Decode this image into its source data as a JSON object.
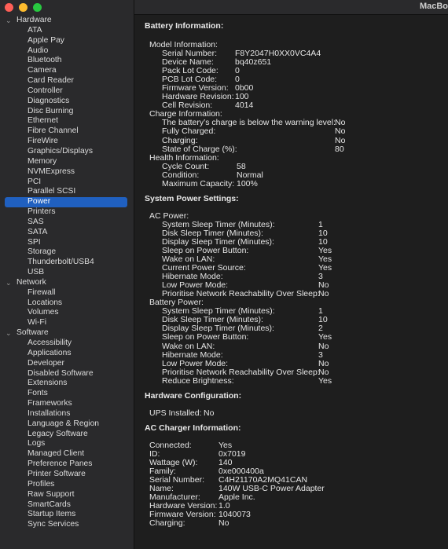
{
  "window": {
    "title": "MacBo"
  },
  "sidebar": {
    "groups": [
      {
        "label": "Hardware",
        "items": [
          "ATA",
          "Apple Pay",
          "Audio",
          "Bluetooth",
          "Camera",
          "Card Reader",
          "Controller",
          "Diagnostics",
          "Disc Burning",
          "Ethernet",
          "Fibre Channel",
          "FireWire",
          "Graphics/Displays",
          "Memory",
          "NVMExpress",
          "PCI",
          "Parallel SCSI",
          "Power",
          "Printers",
          "SAS",
          "SATA",
          "SPI",
          "Storage",
          "Thunderbolt/USB4",
          "USB"
        ]
      },
      {
        "label": "Network",
        "items": [
          "Firewall",
          "Locations",
          "Volumes",
          "Wi-Fi"
        ]
      },
      {
        "label": "Software",
        "items": [
          "Accessibility",
          "Applications",
          "Developer",
          "Disabled Software",
          "Extensions",
          "Fonts",
          "Frameworks",
          "Installations",
          "Language & Region",
          "Legacy Software",
          "Logs",
          "Managed Client",
          "Preference Panes",
          "Printer Software",
          "Profiles",
          "Raw Support",
          "SmartCards",
          "Startup Items",
          "Sync Services"
        ]
      }
    ],
    "selected": "Power"
  },
  "colors": {
    "close": "#fe5f57",
    "minimize": "#febc2e",
    "zoom": "#28c840",
    "selection": "#2060c0"
  },
  "battery": {
    "title": "Battery Information:",
    "model_header": "Model Information:",
    "model": [
      [
        "Serial Number:",
        "F8Y2047H0XX0VC4A4"
      ],
      [
        "Device Name:",
        "bq40z651"
      ],
      [
        "Pack Lot Code:",
        "0"
      ],
      [
        "PCB Lot Code:",
        "0"
      ],
      [
        "Firmware Version:",
        "0b00"
      ],
      [
        "Hardware Revision:",
        "100"
      ],
      [
        "Cell Revision:",
        "4014"
      ]
    ],
    "charge_header": "Charge Information:",
    "charge": [
      [
        "The battery’s charge is below the warning level:",
        "No"
      ],
      [
        "Fully Charged:",
        "No"
      ],
      [
        "Charging:",
        "No"
      ],
      [
        "State of Charge (%):",
        "80"
      ]
    ],
    "health_header": "Health Information:",
    "health": [
      [
        "Cycle Count:",
        "58"
      ],
      [
        "Condition:",
        "Normal"
      ],
      [
        "Maximum Capacity:",
        "100%"
      ]
    ]
  },
  "power_settings": {
    "title": "System Power Settings:",
    "ac_header": "AC Power:",
    "ac": [
      [
        "System Sleep Timer (Minutes):",
        "1"
      ],
      [
        "Disk Sleep Timer (Minutes):",
        "10"
      ],
      [
        "Display Sleep Timer (Minutes):",
        "10"
      ],
      [
        "Sleep on Power Button:",
        "Yes"
      ],
      [
        "Wake on LAN:",
        "Yes"
      ],
      [
        "Current Power Source:",
        "Yes"
      ],
      [
        "Hibernate Mode:",
        "3"
      ],
      [
        "Low Power Mode:",
        "No"
      ],
      [
        "Prioritise Network Reachability Over Sleep:",
        "No"
      ]
    ],
    "battery_header": "Battery Power:",
    "battery": [
      [
        "System Sleep Timer (Minutes):",
        "1"
      ],
      [
        "Disk Sleep Timer (Minutes):",
        "10"
      ],
      [
        "Display Sleep Timer (Minutes):",
        "2"
      ],
      [
        "Sleep on Power Button:",
        "Yes"
      ],
      [
        "Wake on LAN:",
        "No"
      ],
      [
        "Hibernate Mode:",
        "3"
      ],
      [
        "Low Power Mode:",
        "No"
      ],
      [
        "Prioritise Network Reachability Over Sleep:",
        "No"
      ],
      [
        "Reduce Brightness:",
        "Yes"
      ]
    ]
  },
  "hardware_config": {
    "title": "Hardware Configuration:",
    "rows": [
      [
        "UPS Installed:",
        "No"
      ]
    ]
  },
  "charger": {
    "title": "AC Charger Information:",
    "rows": [
      [
        "Connected:",
        "Yes"
      ],
      [
        "ID:",
        "0x7019"
      ],
      [
        "Wattage (W):",
        "140"
      ],
      [
        "Family:",
        "0xe000400a"
      ],
      [
        "Serial Number:",
        "C4H21170A2MQ41CAN"
      ],
      [
        "Name:",
        "140W USB-C Power Adapter"
      ],
      [
        "Manufacturer:",
        "Apple Inc."
      ],
      [
        "Hardware Version:",
        "1.0"
      ],
      [
        "Firmware Version:",
        "1040073"
      ],
      [
        "Charging:",
        "No"
      ]
    ]
  }
}
